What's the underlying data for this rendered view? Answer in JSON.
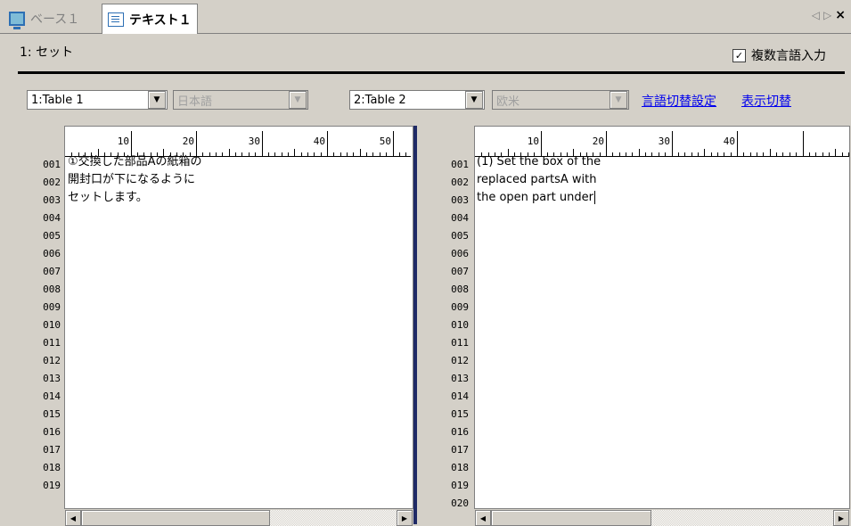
{
  "tabs": {
    "base_label": "ベース１",
    "text_label": "テキスト１",
    "nav_prev": "◁",
    "nav_next": "▷",
    "close": "×"
  },
  "header": {
    "set_label": "1: セット",
    "multi_lang_label": "複数言語入力",
    "multi_lang_checked": true
  },
  "left": {
    "table_select": "1:Table 1",
    "lang_select": "日本語",
    "ruler_marks": [
      "10",
      "20",
      "30",
      "40",
      "50"
    ],
    "line_numbers": [
      "001",
      "002",
      "003",
      "004",
      "005",
      "006",
      "007",
      "008",
      "009",
      "010",
      "011",
      "012",
      "013",
      "014",
      "015",
      "016",
      "017",
      "018",
      "019"
    ],
    "lines": [
      "①交換した部品Aの紙箱の",
      "開封口が下になるように",
      "セットします。"
    ]
  },
  "right": {
    "table_select": "2:Table 2",
    "lang_select": "欧米",
    "ruler_marks": [
      "10",
      "20",
      "30",
      "40"
    ],
    "line_numbers": [
      "001",
      "002",
      "003",
      "004",
      "005",
      "006",
      "007",
      "008",
      "009",
      "010",
      "011",
      "012",
      "013",
      "014",
      "015",
      "016",
      "017",
      "018",
      "019",
      "020"
    ],
    "lines": [
      "(1) Set the box of the",
      "replaced partsA with",
      "the open part under"
    ]
  },
  "links": {
    "lang_switch_settings": "言語切替設定",
    "display_switch": "表示切替"
  },
  "icons": {
    "combo_arrow": "▼",
    "scroll_left": "◀",
    "scroll_right": "▶",
    "check": "✓"
  }
}
